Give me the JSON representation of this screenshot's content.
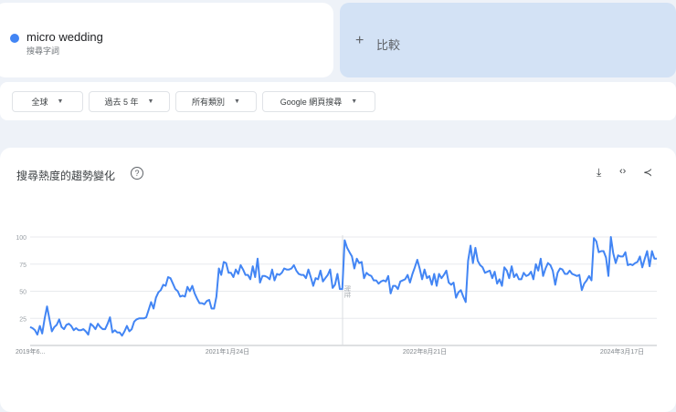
{
  "term": {
    "name": "micro wedding",
    "type": "搜尋字詞",
    "dot_color": "#4285f4"
  },
  "compare": {
    "icon": "plus-icon",
    "label": "比較"
  },
  "filters": [
    {
      "label": "全球"
    },
    {
      "label": "過去 5 年"
    },
    {
      "label": "所有類別"
    },
    {
      "label": "Google 網頁搜尋"
    }
  ],
  "main": {
    "title": "搜尋熱度的趨勢變化",
    "help": "?",
    "icons": [
      "download-icon",
      "embed-icon",
      "share-icon"
    ]
  },
  "chart_data": {
    "type": "line",
    "title": "搜尋熱度的趨勢變化",
    "ylim": [
      0,
      100
    ],
    "yticks": [
      25,
      50,
      75,
      100
    ],
    "xtick_labels": [
      "2019年6...",
      "2021年1月24日",
      "2022年8月21日",
      "2024年3月17日"
    ],
    "annotation": "附註",
    "series": [
      {
        "name": "micro wedding",
        "color": "#4285f4",
        "values": [
          17,
          16,
          14,
          10,
          18,
          11,
          25,
          36,
          24,
          13,
          17,
          19,
          24,
          17,
          15,
          19,
          20,
          18,
          14,
          16,
          14,
          14,
          15,
          13,
          10,
          20,
          18,
          15,
          20,
          17,
          15,
          15,
          20,
          26,
          12,
          14,
          12,
          12,
          9,
          13,
          18,
          13,
          15,
          22,
          24,
          25,
          25,
          25,
          26,
          33,
          40,
          34,
          44,
          49,
          51,
          56,
          55,
          63,
          62,
          57,
          52,
          50,
          45,
          46,
          45,
          54,
          50,
          55,
          48,
          43,
          39,
          39,
          38,
          41,
          42,
          34,
          34,
          45,
          71,
          65,
          77,
          76,
          67,
          67,
          63,
          70,
          66,
          74,
          70,
          65,
          65,
          61,
          73,
          63,
          80,
          58,
          64,
          64,
          63,
          61,
          70,
          60,
          66,
          65,
          67,
          71,
          70,
          70,
          71,
          74,
          69,
          66,
          65,
          65,
          62,
          70,
          63,
          55,
          62,
          61,
          69,
          59,
          62,
          65,
          70,
          53,
          56,
          66,
          52,
          52,
          97,
          90,
          86,
          82,
          71,
          80,
          76,
          77,
          62,
          67,
          65,
          64,
          60,
          60,
          57,
          59,
          60,
          59,
          64,
          48,
          55,
          55,
          52,
          59,
          60,
          61,
          65,
          58,
          66,
          72,
          79,
          71,
          61,
          70,
          62,
          64,
          56,
          66,
          55,
          66,
          62,
          65,
          69,
          58,
          56,
          58,
          44,
          49,
          51,
          45,
          40,
          78,
          92,
          76,
          90,
          78,
          74,
          72,
          67,
          68,
          69,
          62,
          68,
          57,
          61,
          55,
          72,
          69,
          62,
          73,
          63,
          66,
          61,
          61,
          67,
          64,
          65,
          68,
          61,
          75,
          69,
          80,
          64,
          71,
          76,
          74,
          69,
          56,
          67,
          71,
          70,
          66,
          66,
          69,
          66,
          65,
          64,
          65,
          51,
          57,
          60,
          64,
          60,
          99,
          96,
          86,
          87,
          87,
          81,
          64,
          100,
          85,
          76,
          83,
          82,
          82,
          86,
          74,
          75,
          74,
          76,
          77,
          82,
          72,
          80,
          87,
          73,
          87,
          80,
          80
        ]
      }
    ]
  }
}
